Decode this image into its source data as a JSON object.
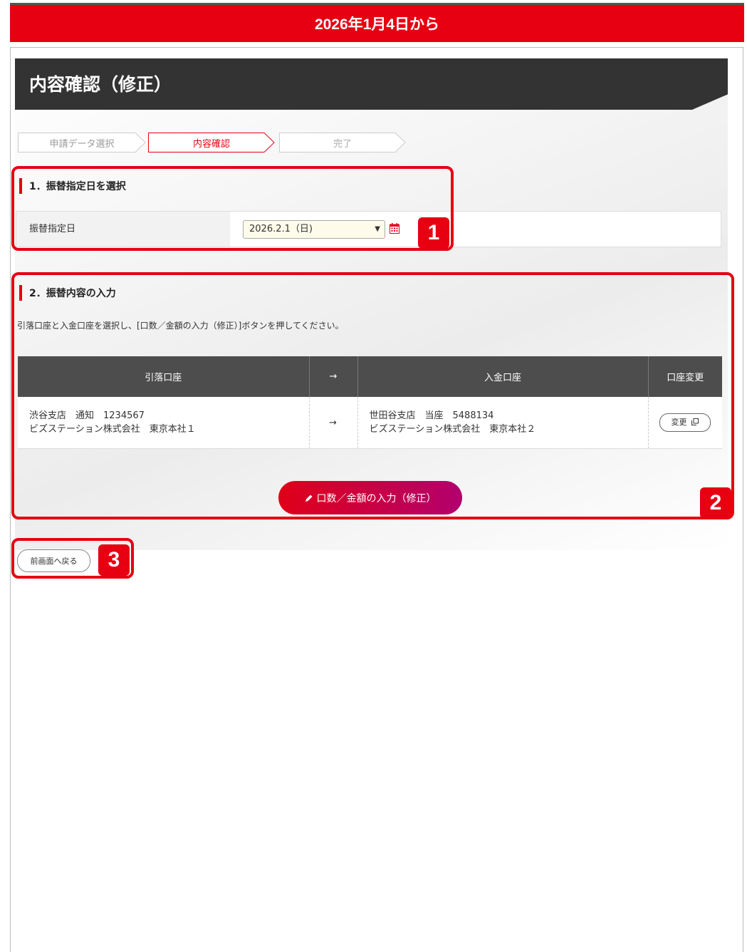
{
  "banner": {
    "text": "2026年1月4日から"
  },
  "page": {
    "title": "内容確認（修正）"
  },
  "steps": [
    {
      "label": "申請データ選択",
      "state": "done"
    },
    {
      "label": "内容確認",
      "state": "current"
    },
    {
      "label": "完了",
      "state": "pending"
    }
  ],
  "section1": {
    "title": "1．振替指定日を選択",
    "date_label": "振替指定日",
    "date_value": "2026.2.1（日)",
    "date_icon": "calendar-icon"
  },
  "section2": {
    "title": "2．振替内容の入力",
    "instruction": "引落口座と入金口座を選択し、[口数／金額の入力（修正）]ボタンを押してください。",
    "headers": [
      "引落口座",
      "→",
      "入金口座",
      "口座変更"
    ],
    "row": {
      "from_line1": "渋谷支店　通知　1234567",
      "from_line2": "ビズステーション株式会社　東京本社１",
      "arrow": "→",
      "to_line1": "世田谷支店　当座　5488134",
      "to_line2": "ビズステーション株式会社　東京本社２",
      "change_label": "変更"
    },
    "main_button": "口数／金額の入力（修正）"
  },
  "back_button": "前画面へ戻る",
  "callouts": [
    "1",
    "2",
    "3"
  ],
  "colors": {
    "accent": "#e60012",
    "header": "#333333",
    "button_end": "#b2006e"
  }
}
